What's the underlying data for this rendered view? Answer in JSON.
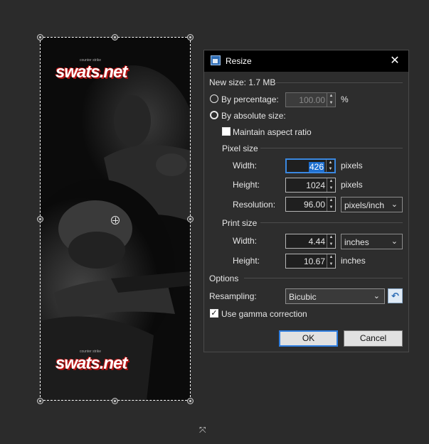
{
  "canvas": {
    "logo_text": "swats.net",
    "logo_sub": "counter strike"
  },
  "dialog": {
    "title": "Resize",
    "close_icon": "close-icon",
    "new_size": "New size: 1.7 MB",
    "by_percentage": {
      "label": "By percentage:",
      "value": "100.00",
      "unit": "%",
      "selected": false
    },
    "by_absolute": {
      "label": "By absolute size:",
      "selected": true
    },
    "maintain_aspect": {
      "label": "Maintain aspect ratio",
      "checked": false
    },
    "pixel_size": {
      "header": "Pixel size",
      "width_label": "Width:",
      "width_value": "426",
      "width_unit": "pixels",
      "height_label": "Height:",
      "height_value": "1024",
      "height_unit": "pixels",
      "resolution_label": "Resolution:",
      "resolution_value": "96.00",
      "resolution_unit": "pixels/inch"
    },
    "print_size": {
      "header": "Print size",
      "width_label": "Width:",
      "width_value": "4.44",
      "width_unit": "inches",
      "height_label": "Height:",
      "height_value": "10.67",
      "height_unit": "inches"
    },
    "options": {
      "header": "Options",
      "resampling_label": "Resampling:",
      "resampling_value": "Bicubic",
      "gamma_label": "Use gamma correction",
      "gamma_checked": true
    },
    "ok_label": "OK",
    "cancel_label": "Cancel"
  },
  "colors": {
    "background": "#2b2b2b",
    "dialog_bg": "#2d2d2d",
    "accent": "#1e6fd0"
  }
}
